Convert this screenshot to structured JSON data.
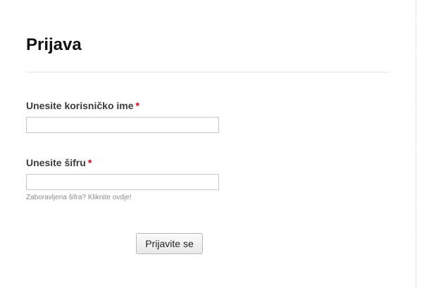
{
  "form": {
    "title": "Prijava",
    "username": {
      "label": "Unesite korisničko ime",
      "required_mark": "*",
      "value": ""
    },
    "password": {
      "label": "Unesite šifru",
      "required_mark": "*",
      "value": ""
    },
    "forgot_password_link": "Zaboravljena šifra? Kliknite ovdje!",
    "submit_label": "Prijavite se"
  },
  "colors": {
    "required": "#d0021b",
    "helper_text": "#8a8a8a",
    "label_text": "#3a3a3a"
  }
}
